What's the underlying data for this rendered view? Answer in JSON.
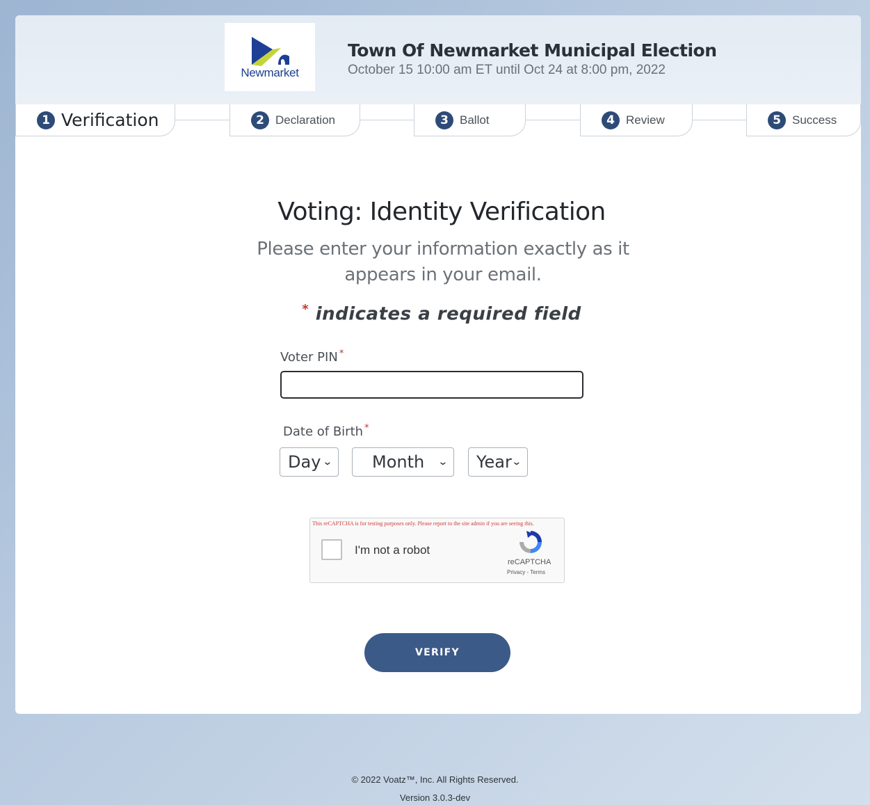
{
  "header": {
    "logo_text": "Newmarket",
    "title": "Town Of Newmarket Municipal Election",
    "subtitle": "October 15 10:00 am ET until Oct 24 at 8:00 pm, 2022"
  },
  "steps": [
    {
      "num": "1",
      "label": "Verification",
      "active": true
    },
    {
      "num": "2",
      "label": "Declaration"
    },
    {
      "num": "3",
      "label": "Ballot"
    },
    {
      "num": "4",
      "label": "Review"
    },
    {
      "num": "5",
      "label": "Success"
    }
  ],
  "form": {
    "heading": "Voting: Identity Verification",
    "intro": "Please enter your information exactly as it appears in your email.",
    "required_note": "indicates a required field",
    "required_star": "*",
    "pin_label": "Voter PIN",
    "pin_value": "",
    "dob_label": "Date of Birth",
    "day_label": "Day",
    "month_label": "Month",
    "year_label": "Year",
    "verify_label": "VERIFY"
  },
  "captcha": {
    "warning": "This reCAPTCHA is for testing purposes only. Please report to the site admin if you are seeing this.",
    "label": "I'm not a robot",
    "brand": "reCAPTCHA",
    "links": "Privacy - Terms"
  },
  "footer": {
    "copyright": "© 2022 Voatz™, Inc. All Rights Reserved.",
    "version": "Version 3.0.3-dev"
  },
  "colors": {
    "primary": "#3c5a88",
    "step_circle": "#2e4b78",
    "required": "#c0392b"
  }
}
